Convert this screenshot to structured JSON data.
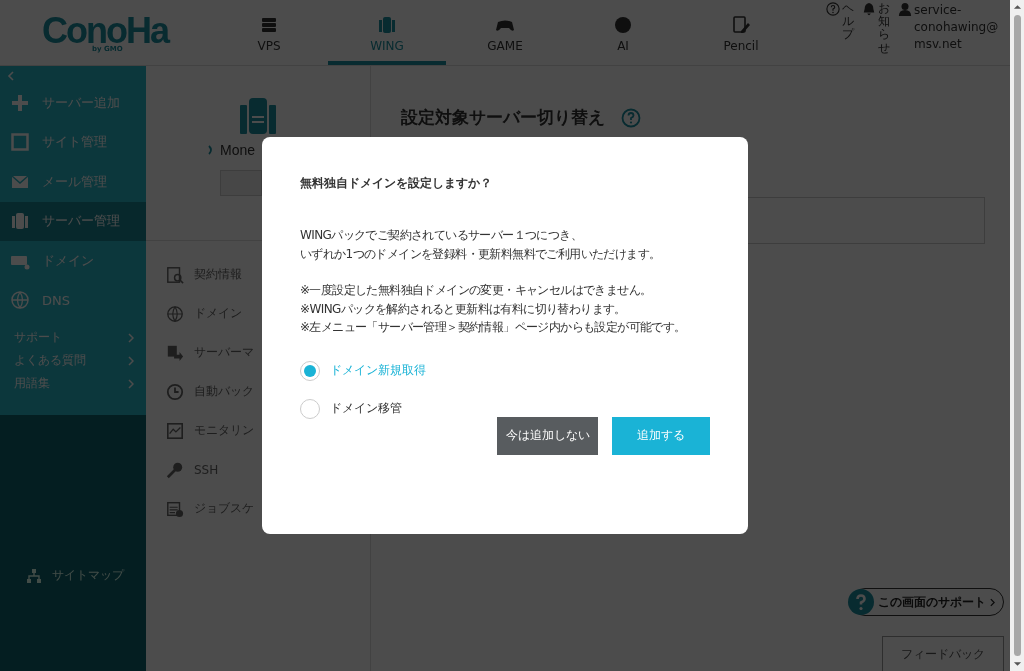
{
  "header": {
    "logo": {
      "text": "ConoHa",
      "sub": "by GMO"
    },
    "tabs": [
      {
        "label": "VPS",
        "selected": false
      },
      {
        "label": "WING",
        "selected": true
      },
      {
        "label": "GAME",
        "selected": false
      },
      {
        "label": "AI",
        "selected": false
      },
      {
        "label": "Pencil",
        "selected": false
      }
    ],
    "help": "ヘルプ",
    "notice": "お知らせ",
    "user": "service-conohawing@msv.net"
  },
  "sidebar": {
    "items": [
      {
        "label": "サーバー追加",
        "selected": false
      },
      {
        "label": "サイト管理",
        "selected": false
      },
      {
        "label": "メール管理",
        "selected": false
      },
      {
        "label": "サーバー管理",
        "selected": true
      },
      {
        "label": "ドメイン",
        "selected": false
      },
      {
        "label": "DNS",
        "selected": false
      }
    ],
    "links": [
      {
        "label": "サポート"
      },
      {
        "label": "よくある質問"
      },
      {
        "label": "用語集"
      }
    ],
    "sitemap": "サイトマップ"
  },
  "server_panel": {
    "name": "Mone",
    "menu": [
      {
        "label": "契約情報"
      },
      {
        "label": "ドメイン"
      },
      {
        "label": "サーバーマ"
      },
      {
        "label": "自動バック"
      },
      {
        "label": "モニタリン"
      },
      {
        "label": "SSH"
      },
      {
        "label": "ジョブスケ"
      }
    ]
  },
  "main": {
    "heading": "設定対象サーバー切り替え"
  },
  "modal": {
    "title": "無料独自ドメインを設定しますか？",
    "paragraphs": [
      [
        "WINGパックでご契約されているサーバー１つにつき、",
        "いずれか1つのドメインを登録料・更新料無料でご利用いただけます。"
      ],
      [
        "※一度設定した無料独自ドメインの変更・キャンセルはできません。",
        "※WINGパックを解約されると更新料は有料に切り替わります。",
        "※左メニュー「サーバー管理＞契約情報」ページ内からも設定が可能です。"
      ]
    ],
    "options": [
      {
        "label": "ドメイン新規取得",
        "selected": true
      },
      {
        "label": "ドメイン移管",
        "selected": false
      }
    ],
    "buttons": [
      {
        "label": "今は追加しない",
        "kind": "secondary"
      },
      {
        "label": "追加する",
        "kind": "primary"
      }
    ]
  },
  "support": "この画面のサポート",
  "feedback": "フィードバック"
}
